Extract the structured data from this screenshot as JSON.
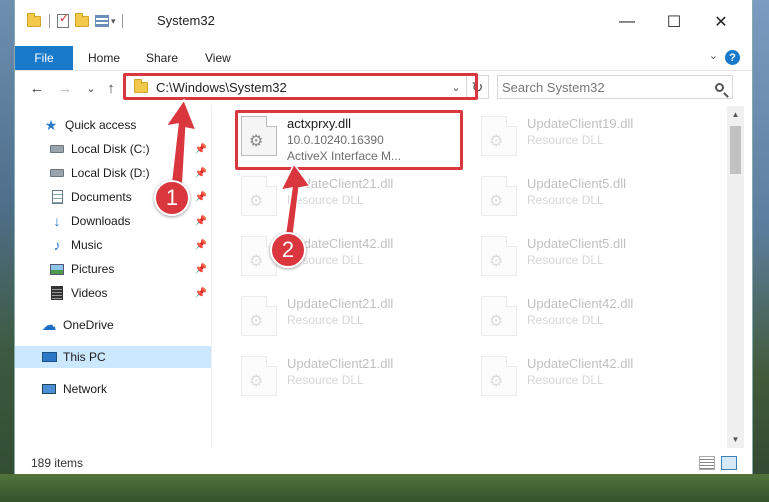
{
  "window": {
    "title": "System32",
    "minimize_glyph": "—",
    "maximize_glyph": "☐",
    "close_glyph": "✕",
    "quick_access_dropdown_glyph": "▾"
  },
  "ribbon": {
    "tabs": [
      "File",
      "Home",
      "Share",
      "View"
    ],
    "help_glyph": "?",
    "collapse_glyph": "⌄"
  },
  "navigation": {
    "back_glyph": "←",
    "forward_glyph": "→",
    "recent_glyph": "⌄",
    "up_glyph": "↑",
    "address": "C:\\Windows\\System32",
    "address_dropdown_glyph": "⌄",
    "refresh_glyph": "↻",
    "search_placeholder": "Search System32"
  },
  "sidebar": {
    "items": [
      {
        "label": "Quick access",
        "icon": "star-icon",
        "pinned": false
      },
      {
        "label": "Local Disk (C:)",
        "icon": "drive-icon",
        "pinned": true
      },
      {
        "label": "Local Disk (D:)",
        "icon": "drive-icon",
        "pinned": true
      },
      {
        "label": "Documents",
        "icon": "documents-icon",
        "pinned": true
      },
      {
        "label": "Downloads",
        "icon": "download-icon",
        "pinned": true
      },
      {
        "label": "Music",
        "icon": "music-icon",
        "pinned": true
      },
      {
        "label": "Pictures",
        "icon": "pictures-icon",
        "pinned": true
      },
      {
        "label": "Videos",
        "icon": "videos-icon",
        "pinned": true
      },
      {
        "label": "OneDrive",
        "icon": "onedrive-icon",
        "pinned": false
      },
      {
        "label": "This PC",
        "icon": "pc-icon",
        "pinned": false,
        "selected": true
      },
      {
        "label": "Network",
        "icon": "network-icon",
        "pinned": false
      }
    ],
    "pin_glyph": "📌"
  },
  "files": [
    {
      "name": "actxprxy.dll",
      "line2": "10.0.10240.16390",
      "line3": "ActiveX Interface M...",
      "highlighted": true
    },
    {
      "name": "UpdateClient19.dll",
      "line2": "Resource DLL"
    },
    {
      "name": "UpdateClient21.dll",
      "line2": "Resource DLL"
    },
    {
      "name": "UpdateClient5.dll",
      "line2": "Resource DLL"
    },
    {
      "name": "UpdateClient42.dll",
      "line2": "Resource DLL"
    },
    {
      "name": "UpdateClient5.dll",
      "line2": "Resource DLL"
    },
    {
      "name": "UpdateClient21.dll",
      "line2": "Resource DLL"
    },
    {
      "name": "UpdateClient42.dll",
      "line2": "Resource DLL"
    },
    {
      "name": "UpdateClient21.dll",
      "line2": "Resource DLL"
    },
    {
      "name": "UpdateClient42.dll",
      "line2": "Resource DLL"
    }
  ],
  "status": {
    "item_count": "189 items"
  },
  "annotations": {
    "badge_1": "1",
    "badge_2": "2",
    "color": "#d9363e"
  },
  "scrollbar": {
    "up_glyph": "▲",
    "down_glyph": "▼"
  }
}
